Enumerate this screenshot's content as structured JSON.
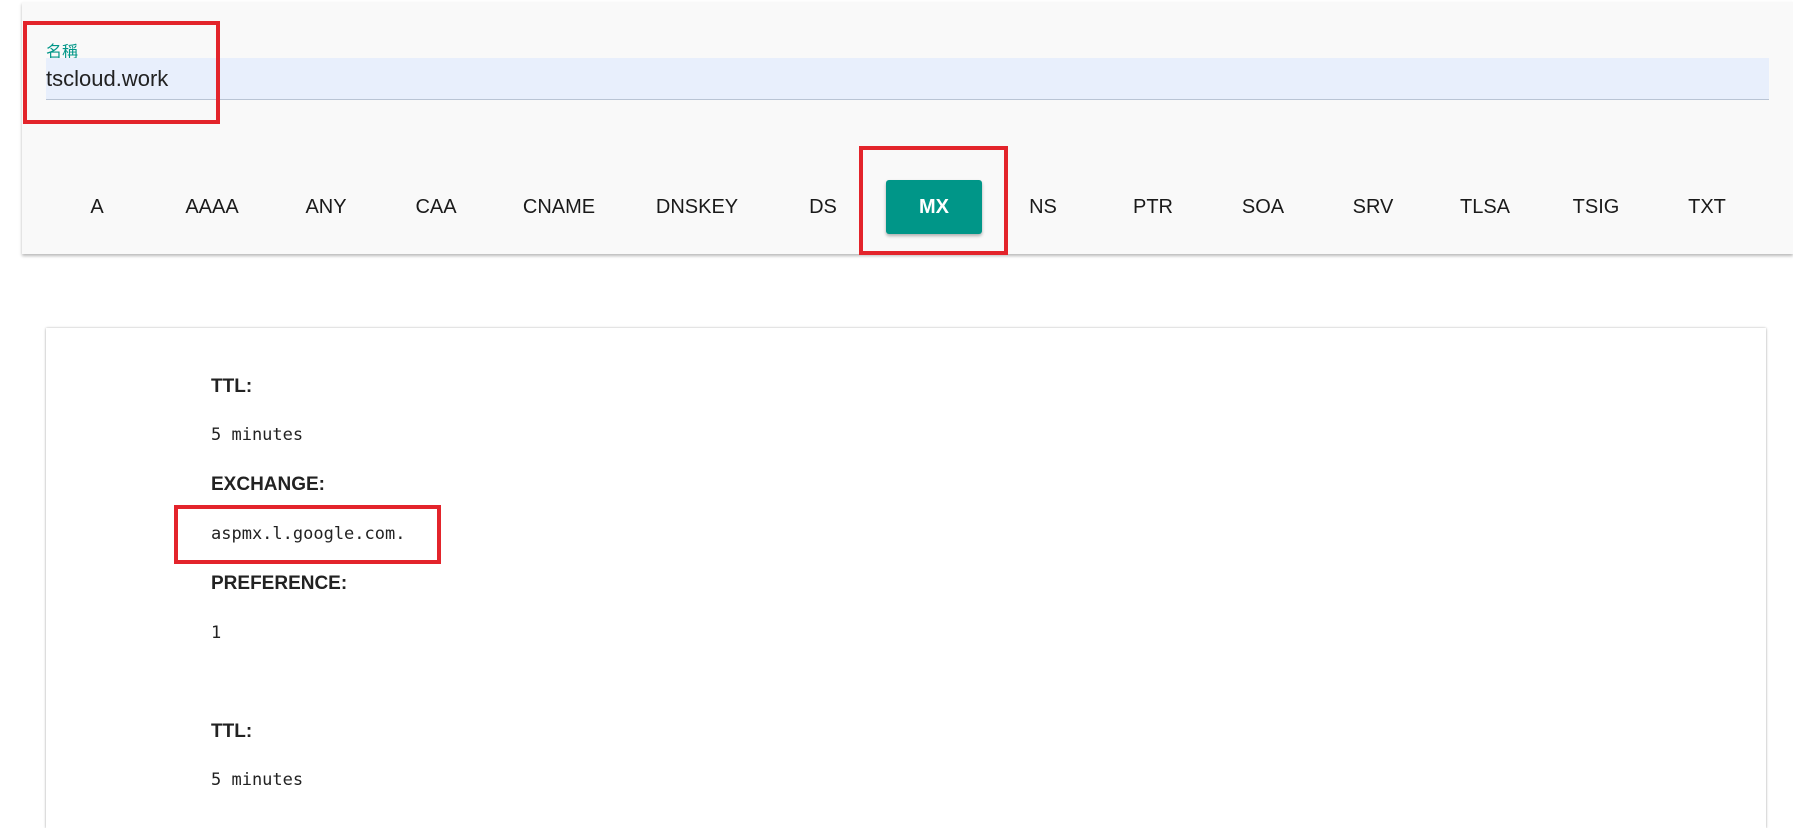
{
  "name_field": {
    "label": "名稱",
    "value": "tscloud.work"
  },
  "record_types": {
    "items": [
      "A",
      "AAAA",
      "ANY",
      "CAA",
      "CNAME",
      "DNSKEY",
      "DS",
      "MX",
      "NS",
      "PTR",
      "SOA",
      "SRV",
      "TLSA",
      "TSIG",
      "TXT"
    ],
    "selected": "MX"
  },
  "records": [
    {
      "ttl_label": "TTL:",
      "ttl_value": "5 minutes",
      "exchange_label": "EXCHANGE:",
      "exchange_value": "aspmx.l.google.com.",
      "preference_label": "PREFERENCE:",
      "preference_value": "1"
    },
    {
      "ttl_label": "TTL:",
      "ttl_value": "5 minutes"
    }
  ],
  "colors": {
    "accent": "#009688",
    "highlight": "#e3242b",
    "field_bg": "#e8effc"
  }
}
